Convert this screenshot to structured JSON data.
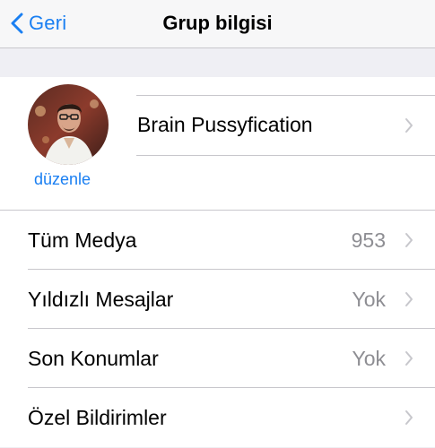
{
  "nav": {
    "back_label": "Geri",
    "title": "Grup bilgisi"
  },
  "group": {
    "name": "Brain Pussyfication",
    "edit_label": "düzenle"
  },
  "rows": [
    {
      "label": "Tüm Medya",
      "value": "953"
    },
    {
      "label": "Yıldızlı Mesajlar",
      "value": "Yok"
    },
    {
      "label": "Son Konumlar",
      "value": "Yok"
    },
    {
      "label": "Özel Bildirimler",
      "value": ""
    }
  ],
  "colors": {
    "accent": "#1a7ff2",
    "background": "#efeff4",
    "separator": "#c8c7cc",
    "secondary_text": "#8e8e93"
  }
}
